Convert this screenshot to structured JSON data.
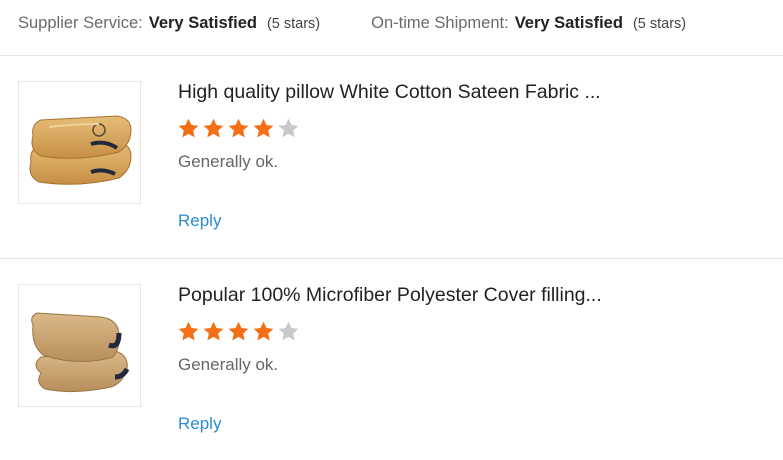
{
  "ratings": {
    "supplier_service": {
      "label": "Supplier Service:",
      "value": "Very Satisfied",
      "stars": "(5 stars)"
    },
    "on_time_shipment": {
      "label": "On-time Shipment:",
      "value": "Very Satisfied",
      "stars": "(5 stars)"
    }
  },
  "reviews": [
    {
      "product_title": "High quality pillow White Cotton Sateen Fabric ...",
      "rating": 4,
      "max_rating": 5,
      "comment": "Generally ok.",
      "reply_label": "Reply"
    },
    {
      "product_title": "Popular 100% Microfiber Polyester Cover filling...",
      "rating": 4,
      "max_rating": 5,
      "comment": "Generally ok.",
      "reply_label": "Reply"
    }
  ],
  "colors": {
    "star_filled": "#f46f16",
    "star_empty": "#c9c9c9",
    "link": "#2a8bd0",
    "divider": "#e2e2e2"
  }
}
